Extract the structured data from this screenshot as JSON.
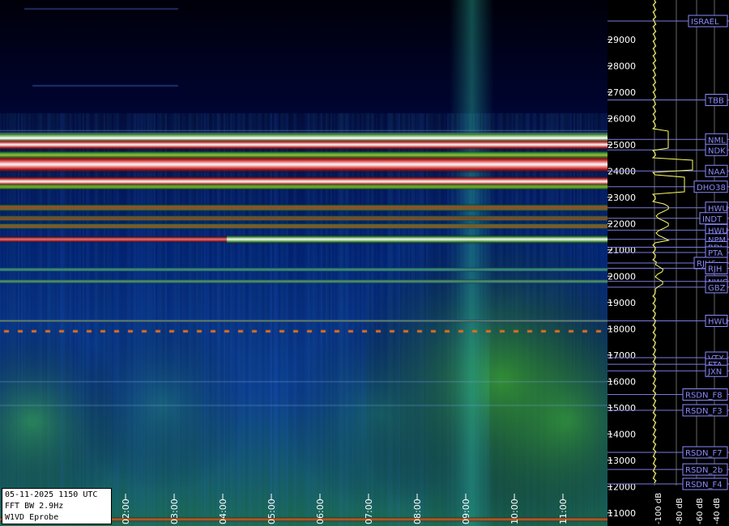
{
  "info_box": {
    "line1": "05-11-2025 1150 UTC",
    "line2": "FFT BW 2.9Hz",
    "line3": "W1VD Eprobe"
  },
  "time_axis": {
    "labels": [
      "02:00",
      "03:00",
      "04:00",
      "05:00",
      "06:00",
      "07:00",
      "08:00",
      "09:00",
      "10:00",
      "11:00"
    ]
  },
  "frequency_axis": {
    "labels": [
      "29000",
      "28000",
      "27000",
      "26000",
      "25000",
      "24000",
      "23000",
      "22000",
      "21000",
      "20000",
      "19000",
      "18000",
      "17000",
      "16000",
      "15000",
      "14000",
      "13000",
      "12000",
      "11000"
    ],
    "min_hz": 10500,
    "max_hz": 30500
  },
  "power_axis": {
    "labels": [
      "-100 dB",
      "-80 dB",
      "-60 dB",
      "-40 dB"
    ]
  },
  "stations": [
    {
      "label": "ISRAEL",
      "freq": 29700
    },
    {
      "label": "TBB",
      "freq": 26700
    },
    {
      "label": "NML",
      "freq": 25200
    },
    {
      "label": "NDK",
      "freq": 24800
    },
    {
      "label": "NAA",
      "freq": 24000
    },
    {
      "label": "DHO38",
      "freq": 23400
    },
    {
      "label": "HWU",
      "freq": 22600
    },
    {
      "label": "INDT",
      "freq": 22200
    },
    {
      "label": "HWU",
      "freq": 21750
    },
    {
      "label": "NPM",
      "freq": 21400
    },
    {
      "label": "RDL",
      "freq": 21100
    },
    {
      "label": "PTA",
      "freq": 20900
    },
    {
      "label": "RJH6x",
      "freq": 20500
    },
    {
      "label": "RJH",
      "freq": 20300
    },
    {
      "label": "NWC",
      "freq": 19800
    },
    {
      "label": "GBZ",
      "freq": 19580
    },
    {
      "label": "HWU",
      "freq": 18300
    },
    {
      "label": "VTX",
      "freq": 16900
    },
    {
      "label": "FTA",
      "freq": 16650
    },
    {
      "label": "JXN",
      "freq": 16400
    },
    {
      "label": "RSDN_F8",
      "freq": 15500
    },
    {
      "label": "RSDN_F3",
      "freq": 14900
    },
    {
      "label": "RSDN_F7",
      "freq": 13300
    },
    {
      "label": "RSDN_2b",
      "freq": 12650
    },
    {
      "label": "RSDN_F4",
      "freq": 12100
    }
  ],
  "colors": {
    "scale_labels": "#ffffff",
    "station_box": "#8a8aff",
    "trace": "#ffff66"
  }
}
